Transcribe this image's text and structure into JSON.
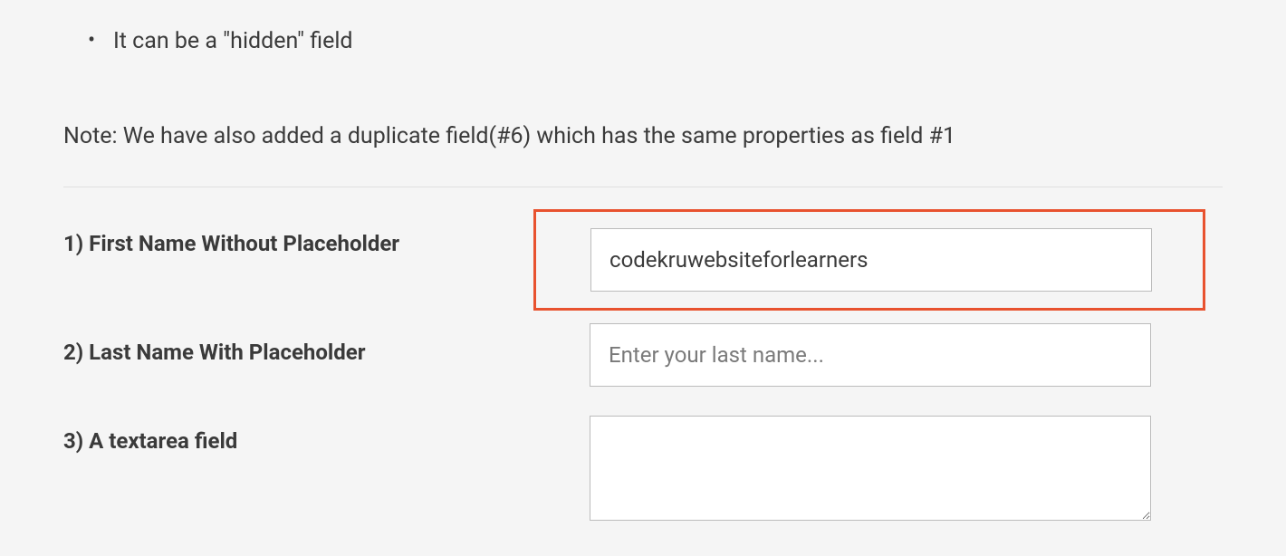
{
  "bullet": {
    "text": "It can be a \"hidden\" field"
  },
  "note": {
    "text": "Note: We have also added a duplicate field(#6) which has the same properties as field #1"
  },
  "fields": {
    "firstName": {
      "label": "1) First Name Without Placeholder",
      "value": "codekruwebsiteforlearners"
    },
    "lastName": {
      "label": "2) Last Name With Placeholder",
      "placeholder": "Enter your last name..."
    },
    "textarea": {
      "label": "3) A textarea field"
    }
  }
}
